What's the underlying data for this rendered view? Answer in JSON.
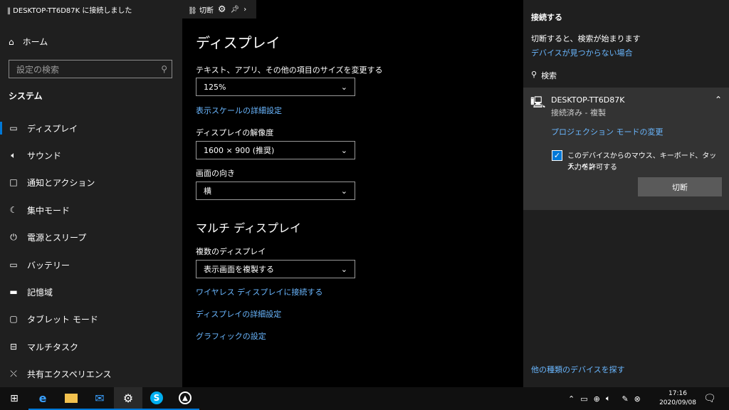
{
  "titlebar": {
    "text": "‖ DESKTOP-TT6D87K に接続しました"
  },
  "conn_toolbar": {
    "disconnect_label": "切断"
  },
  "sidebar": {
    "home": "ホーム",
    "search_placeholder": "設定の検索",
    "section": "システム",
    "items": [
      {
        "label": "ディスプレイ",
        "icon": "monitor-icon"
      },
      {
        "label": "サウンド",
        "icon": "speaker-icon"
      },
      {
        "label": "通知とアクション",
        "icon": "notification-icon"
      },
      {
        "label": "集中モード",
        "icon": "moon-icon"
      },
      {
        "label": "電源とスリープ",
        "icon": "power-icon"
      },
      {
        "label": "バッテリー",
        "icon": "battery-icon"
      },
      {
        "label": "記憶域",
        "icon": "storage-icon"
      },
      {
        "label": "タブレット モード",
        "icon": "tablet-icon"
      },
      {
        "label": "マルチタスク",
        "icon": "multitask-icon"
      },
      {
        "label": "共有エクスペリエンス",
        "icon": "share-icon"
      }
    ]
  },
  "main": {
    "title": "ディスプレイ",
    "scale_label": "テキスト、アプリ、その他の項目のサイズを変更する",
    "scale_value": "125%",
    "scale_link": "表示スケールの詳細設定",
    "resolution_label": "ディスプレイの解像度",
    "resolution_value": "1600 × 900 (推奨)",
    "orientation_label": "画面の向き",
    "orientation_value": "横",
    "multi_title": "マルチ ディスプレイ",
    "multi_label": "複数のディスプレイ",
    "multi_value": "表示画面を複製する",
    "link_wireless": "ワイヤレス ディスプレイに接続する",
    "link_advanced": "ディスプレイの詳細設定",
    "link_graphics": "グラフィックの設定"
  },
  "connect_panel": {
    "title": "接続する",
    "info": "切断すると、検索が始まります",
    "not_found_link": "デバイスが見つからない場合",
    "search_label": "検索",
    "device_name": "DESKTOP-TT6D87K",
    "device_status": "接続済み - 複製",
    "projection_link": "プロジェクション モードの変更",
    "checkbox_label_1": "このデバイスからのマウス、キーボード、タッチ、ペン",
    "checkbox_label_2": "入力を許可する",
    "checkbox_checked": true,
    "disconnect_button": "切断",
    "other_devices_link": "他の種類のデバイスを探す"
  },
  "taskbar": {
    "time": "17:16",
    "date": "2020/09/08",
    "accent": "#0078d7"
  }
}
